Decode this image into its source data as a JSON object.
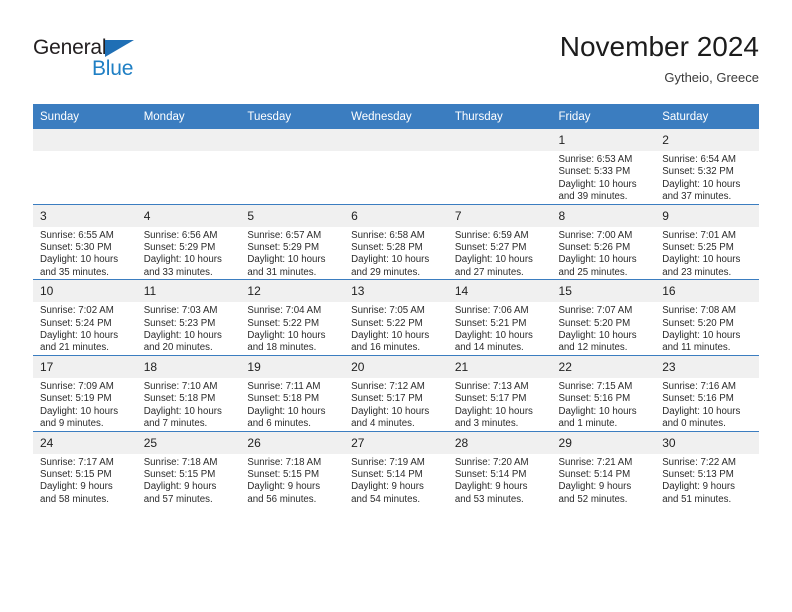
{
  "brand": {
    "name_part1": "General",
    "name_part2": "Blue"
  },
  "header": {
    "title": "November 2024",
    "location": "Gytheio, Greece"
  },
  "weekday_headers": [
    "Sunday",
    "Monday",
    "Tuesday",
    "Wednesday",
    "Thursday",
    "Friday",
    "Saturday"
  ],
  "colors": {
    "header_blue": "#3b7dc0",
    "brand_blue": "#1f7fc4",
    "daynum_band": "#f0f0f0"
  },
  "labels": {
    "sunrise_prefix": "Sunrise:",
    "sunset_prefix": "Sunset:",
    "daylight_prefix": "Daylight:"
  },
  "weeks": [
    [
      {
        "day": "",
        "empty": true
      },
      {
        "day": "",
        "empty": true
      },
      {
        "day": "",
        "empty": true
      },
      {
        "day": "",
        "empty": true
      },
      {
        "day": "",
        "empty": true
      },
      {
        "day": "1",
        "sunrise": "Sunrise: 6:53 AM",
        "sunset": "Sunset: 5:33 PM",
        "daylight": "Daylight: 10 hours and 39 minutes."
      },
      {
        "day": "2",
        "sunrise": "Sunrise: 6:54 AM",
        "sunset": "Sunset: 5:32 PM",
        "daylight": "Daylight: 10 hours and 37 minutes."
      }
    ],
    [
      {
        "day": "3",
        "sunrise": "Sunrise: 6:55 AM",
        "sunset": "Sunset: 5:30 PM",
        "daylight": "Daylight: 10 hours and 35 minutes."
      },
      {
        "day": "4",
        "sunrise": "Sunrise: 6:56 AM",
        "sunset": "Sunset: 5:29 PM",
        "daylight": "Daylight: 10 hours and 33 minutes."
      },
      {
        "day": "5",
        "sunrise": "Sunrise: 6:57 AM",
        "sunset": "Sunset: 5:29 PM",
        "daylight": "Daylight: 10 hours and 31 minutes."
      },
      {
        "day": "6",
        "sunrise": "Sunrise: 6:58 AM",
        "sunset": "Sunset: 5:28 PM",
        "daylight": "Daylight: 10 hours and 29 minutes."
      },
      {
        "day": "7",
        "sunrise": "Sunrise: 6:59 AM",
        "sunset": "Sunset: 5:27 PM",
        "daylight": "Daylight: 10 hours and 27 minutes."
      },
      {
        "day": "8",
        "sunrise": "Sunrise: 7:00 AM",
        "sunset": "Sunset: 5:26 PM",
        "daylight": "Daylight: 10 hours and 25 minutes."
      },
      {
        "day": "9",
        "sunrise": "Sunrise: 7:01 AM",
        "sunset": "Sunset: 5:25 PM",
        "daylight": "Daylight: 10 hours and 23 minutes."
      }
    ],
    [
      {
        "day": "10",
        "sunrise": "Sunrise: 7:02 AM",
        "sunset": "Sunset: 5:24 PM",
        "daylight": "Daylight: 10 hours and 21 minutes."
      },
      {
        "day": "11",
        "sunrise": "Sunrise: 7:03 AM",
        "sunset": "Sunset: 5:23 PM",
        "daylight": "Daylight: 10 hours and 20 minutes."
      },
      {
        "day": "12",
        "sunrise": "Sunrise: 7:04 AM",
        "sunset": "Sunset: 5:22 PM",
        "daylight": "Daylight: 10 hours and 18 minutes."
      },
      {
        "day": "13",
        "sunrise": "Sunrise: 7:05 AM",
        "sunset": "Sunset: 5:22 PM",
        "daylight": "Daylight: 10 hours and 16 minutes."
      },
      {
        "day": "14",
        "sunrise": "Sunrise: 7:06 AM",
        "sunset": "Sunset: 5:21 PM",
        "daylight": "Daylight: 10 hours and 14 minutes."
      },
      {
        "day": "15",
        "sunrise": "Sunrise: 7:07 AM",
        "sunset": "Sunset: 5:20 PM",
        "daylight": "Daylight: 10 hours and 12 minutes."
      },
      {
        "day": "16",
        "sunrise": "Sunrise: 7:08 AM",
        "sunset": "Sunset: 5:20 PM",
        "daylight": "Daylight: 10 hours and 11 minutes."
      }
    ],
    [
      {
        "day": "17",
        "sunrise": "Sunrise: 7:09 AM",
        "sunset": "Sunset: 5:19 PM",
        "daylight": "Daylight: 10 hours and 9 minutes."
      },
      {
        "day": "18",
        "sunrise": "Sunrise: 7:10 AM",
        "sunset": "Sunset: 5:18 PM",
        "daylight": "Daylight: 10 hours and 7 minutes."
      },
      {
        "day": "19",
        "sunrise": "Sunrise: 7:11 AM",
        "sunset": "Sunset: 5:18 PM",
        "daylight": "Daylight: 10 hours and 6 minutes."
      },
      {
        "day": "20",
        "sunrise": "Sunrise: 7:12 AM",
        "sunset": "Sunset: 5:17 PM",
        "daylight": "Daylight: 10 hours and 4 minutes."
      },
      {
        "day": "21",
        "sunrise": "Sunrise: 7:13 AM",
        "sunset": "Sunset: 5:17 PM",
        "daylight": "Daylight: 10 hours and 3 minutes."
      },
      {
        "day": "22",
        "sunrise": "Sunrise: 7:15 AM",
        "sunset": "Sunset: 5:16 PM",
        "daylight": "Daylight: 10 hours and 1 minute."
      },
      {
        "day": "23",
        "sunrise": "Sunrise: 7:16 AM",
        "sunset": "Sunset: 5:16 PM",
        "daylight": "Daylight: 10 hours and 0 minutes."
      }
    ],
    [
      {
        "day": "24",
        "sunrise": "Sunrise: 7:17 AM",
        "sunset": "Sunset: 5:15 PM",
        "daylight": "Daylight: 9 hours and 58 minutes."
      },
      {
        "day": "25",
        "sunrise": "Sunrise: 7:18 AM",
        "sunset": "Sunset: 5:15 PM",
        "daylight": "Daylight: 9 hours and 57 minutes."
      },
      {
        "day": "26",
        "sunrise": "Sunrise: 7:18 AM",
        "sunset": "Sunset: 5:15 PM",
        "daylight": "Daylight: 9 hours and 56 minutes."
      },
      {
        "day": "27",
        "sunrise": "Sunrise: 7:19 AM",
        "sunset": "Sunset: 5:14 PM",
        "daylight": "Daylight: 9 hours and 54 minutes."
      },
      {
        "day": "28",
        "sunrise": "Sunrise: 7:20 AM",
        "sunset": "Sunset: 5:14 PM",
        "daylight": "Daylight: 9 hours and 53 minutes."
      },
      {
        "day": "29",
        "sunrise": "Sunrise: 7:21 AM",
        "sunset": "Sunset: 5:14 PM",
        "daylight": "Daylight: 9 hours and 52 minutes."
      },
      {
        "day": "30",
        "sunrise": "Sunrise: 7:22 AM",
        "sunset": "Sunset: 5:13 PM",
        "daylight": "Daylight: 9 hours and 51 minutes."
      }
    ]
  ]
}
